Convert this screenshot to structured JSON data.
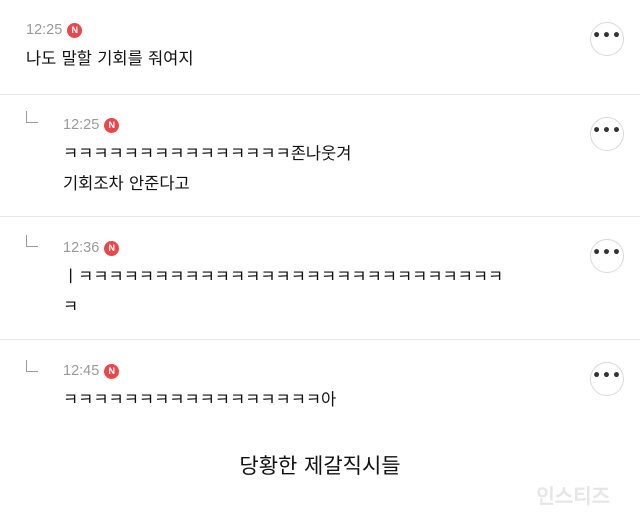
{
  "comments": [
    {
      "time": "12:25",
      "badge": "N",
      "text": "나도 말할 기회를 줘여지"
    },
    {
      "time": "12:25",
      "badge": "N",
      "text": "ㅋㅋㅋㅋㅋㅋㅋㅋㅋㅋㅋㅋㅋㅋㅋ존나웃겨\n기회조차 안준다고"
    },
    {
      "time": "12:36",
      "badge": "N",
      "text": "ㅣㅋㅋㅋㅋㅋㅋㅋㅋㅋㅋㅋㅋㅋㅋㅋㅋㅋㅋㅋㅋㅋㅋㅋㅋㅋㅋㅋㅋ\nㅋ"
    },
    {
      "time": "12:45",
      "badge": "N",
      "text": "ㅋㅋㅋㅋㅋㅋㅋㅋㅋㅋㅋㅋㅋㅋㅋㅋㅋ아"
    }
  ],
  "more_label": "•••",
  "caption": "당황한 제갈직시들",
  "watermark": "인스티즈"
}
